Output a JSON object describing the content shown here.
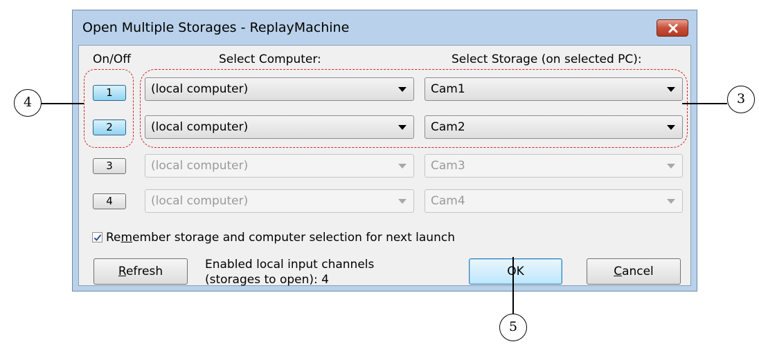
{
  "window": {
    "title": "Open Multiple Storages - ReplayMachine"
  },
  "headers": {
    "on_off": "On/Off",
    "select_computer": "Select Computer:",
    "select_storage": "Select Storage (on selected PC):"
  },
  "rows": [
    {
      "channel": "1",
      "computer": "(local computer)",
      "storage": "Cam1",
      "enabled": true
    },
    {
      "channel": "2",
      "computer": "(local computer)",
      "storage": "Cam2",
      "enabled": true
    },
    {
      "channel": "3",
      "computer": "(local computer)",
      "storage": "Cam3",
      "enabled": false
    },
    {
      "channel": "4",
      "computer": "(local computer)",
      "storage": "Cam4",
      "enabled": false
    }
  ],
  "remember": {
    "checked": true,
    "label_pre": "Re",
    "label_underlined": "m",
    "label_post": "ember storage and computer selection for next launch"
  },
  "info": {
    "line1": "Enabled local input channels",
    "line2": "(storages to open): 4"
  },
  "buttons": {
    "refresh_u": "R",
    "refresh_rest": "efresh",
    "ok": "OK",
    "cancel_u": "C",
    "cancel_rest": "ancel"
  },
  "callouts": {
    "c3": "3",
    "c4": "4",
    "c5": "5"
  },
  "colors": {
    "frame": "#b9d1ea",
    "callout_dash": "#d32020"
  }
}
